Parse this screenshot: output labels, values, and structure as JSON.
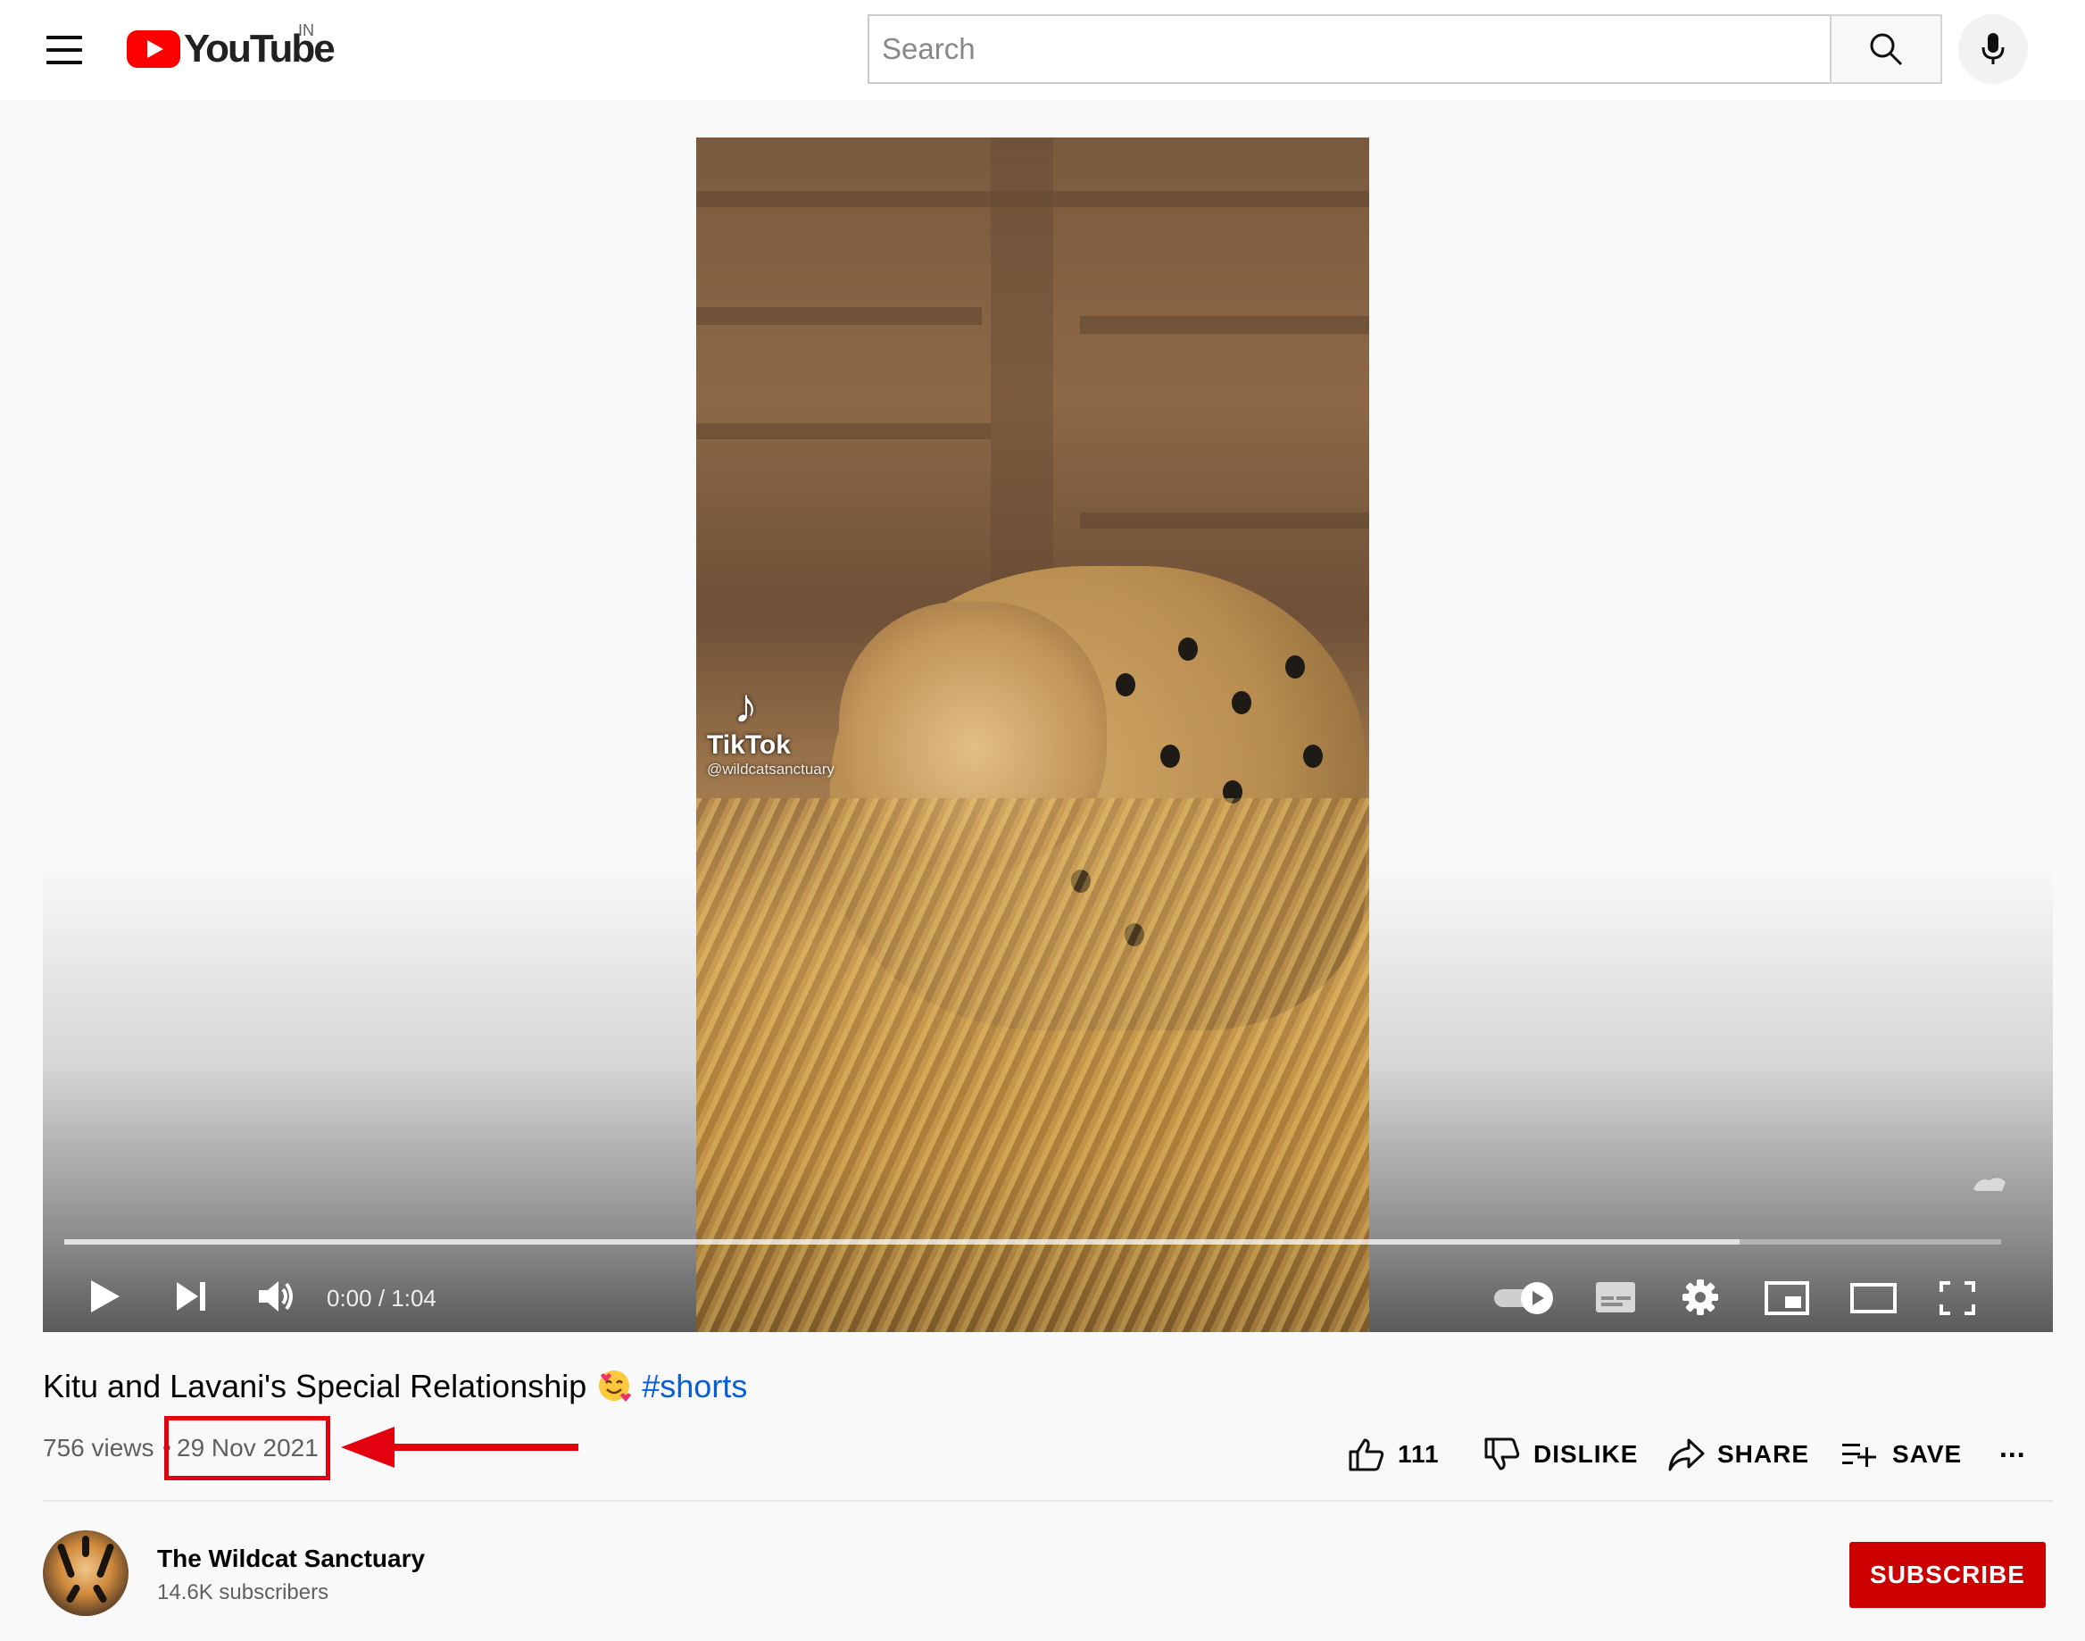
{
  "header": {
    "logo_text": "YouTube",
    "country_code": "IN",
    "search_placeholder": "Search"
  },
  "player": {
    "time_display": "0:00 / 1:04",
    "progress_loaded_fraction": 0.865,
    "overlay": {
      "tiktok_name": "TikTok",
      "tiktok_handle": "@wildcatsanctuary"
    }
  },
  "video": {
    "title": "Kitu and Lavani's Special Relationship",
    "title_emoji": "🥰",
    "hashtag": "#shorts",
    "views": "756 views",
    "separator": "•",
    "date": "29 Nov 2021"
  },
  "actions": {
    "like_count": "111",
    "dislike_label": "DISLIKE",
    "share_label": "SHARE",
    "save_label": "SAVE",
    "more_label": "..."
  },
  "channel": {
    "name": "The Wildcat Sanctuary",
    "subscribers": "14.6K subscribers",
    "subscribe_label": "SUBSCRIBE"
  },
  "colors": {
    "brand_red": "#ff0000",
    "subscribe_red": "#cc0000",
    "annotation_red": "#e3000f",
    "hashtag_blue": "#065fd4"
  }
}
